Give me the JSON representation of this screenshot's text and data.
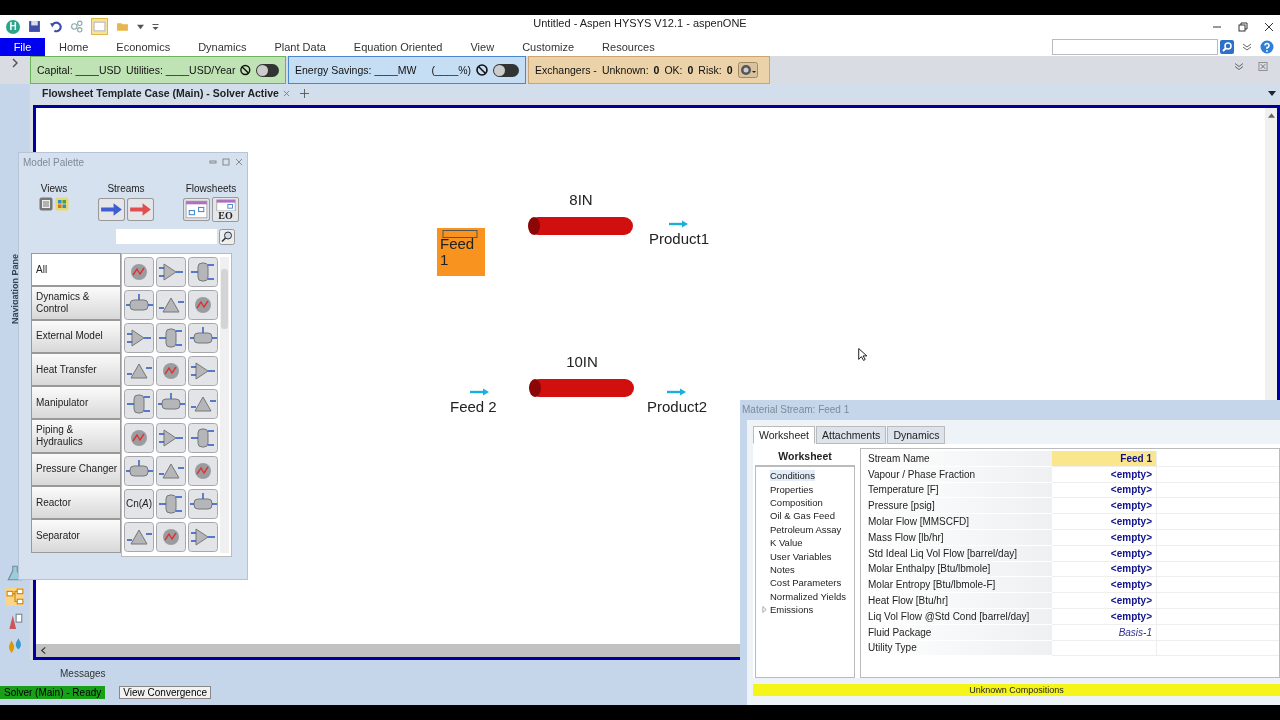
{
  "window": {
    "app_badge": "H",
    "title": "Untitled - Aspen HYSYS V12.1 - aspenONE"
  },
  "ribbon": {
    "file_tab": "File",
    "tabs": [
      {
        "label": "Home",
        "selected": false
      },
      {
        "label": "Economics",
        "selected": false
      },
      {
        "label": "Dynamics",
        "selected": false
      },
      {
        "label": "Plant Data",
        "selected": false
      },
      {
        "label": "Equation Oriented",
        "selected": false
      },
      {
        "label": "View",
        "selected": false
      },
      {
        "label": "Customize",
        "selected": false
      },
      {
        "label": "Resources",
        "selected": false
      }
    ]
  },
  "economics_bar": {
    "capital": "Capital: ____USD",
    "utilities": "Utilities: ____USD/Year",
    "on": false
  },
  "energy_bar": {
    "savings": "Energy Savings: ____MW",
    "percent": "(____%)",
    "on": false
  },
  "exchangers_bar": {
    "label": "Exchangers -",
    "counts": [
      {
        "label": "Unknown:",
        "value": "0"
      },
      {
        "label": "OK:",
        "value": "0"
      },
      {
        "label": "Risk:",
        "value": "0"
      }
    ]
  },
  "document_tab": {
    "label": "Flowsheet Template Case (Main) - Solver Active"
  },
  "navigation_pane": {
    "label": "Navigation Pane"
  },
  "model_palette": {
    "title": "Model Palette",
    "groups": [
      "Views",
      "Streams",
      "Flowsheets"
    ],
    "eo_label": "EO",
    "categories": [
      {
        "label": "All",
        "selected": true
      },
      {
        "label": "Dynamics & Control",
        "selected": false
      },
      {
        "label": "External Model",
        "selected": false
      },
      {
        "label": "Heat Transfer",
        "selected": false
      },
      {
        "label": "Manipulator",
        "selected": false
      },
      {
        "label": "Piping & Hydraulics",
        "selected": false
      },
      {
        "label": "Pressure Changer",
        "selected": false
      },
      {
        "label": "Reactor",
        "selected": false
      },
      {
        "label": "Separator",
        "selected": false
      }
    ],
    "formula_tile": "Cn(*A*)"
  },
  "flowsheet": {
    "objects": [
      {
        "kind": "stream",
        "label": "Feed 1",
        "selected": true
      },
      {
        "kind": "pipe",
        "label": "8IN",
        "selected": false
      },
      {
        "kind": "stream",
        "label": "Product1",
        "selected": false
      },
      {
        "kind": "stream",
        "label": "Feed 2",
        "selected": false
      },
      {
        "kind": "pipe",
        "label": "10IN",
        "selected": false
      },
      {
        "kind": "stream",
        "label": "Product2",
        "selected": false
      }
    ]
  },
  "material_stream": {
    "title": "Material Stream: Feed 1",
    "tabs": [
      {
        "label": "Worksheet",
        "selected": true
      },
      {
        "label": "Attachments",
        "selected": false
      },
      {
        "label": "Dynamics",
        "selected": false
      }
    ],
    "nav_heading": "Worksheet",
    "nav_items": [
      {
        "label": "Conditions",
        "selected": true
      },
      {
        "label": "Properties",
        "selected": false
      },
      {
        "label": "Composition",
        "selected": false
      },
      {
        "label": "Oil & Gas Feed",
        "selected": false
      },
      {
        "label": "Petroleum Assay",
        "selected": false
      },
      {
        "label": "K Value",
        "selected": false
      },
      {
        "label": "User Variables",
        "selected": false
      },
      {
        "label": "Notes",
        "selected": false
      },
      {
        "label": "Cost Parameters",
        "selected": false
      },
      {
        "label": "Normalized Yields",
        "selected": false
      },
      {
        "label": "Emissions",
        "selected": false,
        "expanded": false
      }
    ],
    "rows": [
      {
        "name": "Stream Name",
        "value": "Feed 1",
        "kind": "name"
      },
      {
        "name": "Vapour / Phase Fraction",
        "value": "<empty>",
        "kind": "empty"
      },
      {
        "name": "Temperature [F]",
        "value": "<empty>",
        "kind": "empty"
      },
      {
        "name": "Pressure [psig]",
        "value": "<empty>",
        "kind": "empty"
      },
      {
        "name": "Molar Flow [MMSCFD]",
        "value": "<empty>",
        "kind": "empty"
      },
      {
        "name": "Mass Flow [lb/hr]",
        "value": "<empty>",
        "kind": "empty"
      },
      {
        "name": "Std Ideal Liq Vol Flow [barrel/day]",
        "value": "<empty>",
        "kind": "empty"
      },
      {
        "name": "Molar Enthalpy [Btu/lbmole]",
        "value": "<empty>",
        "kind": "empty"
      },
      {
        "name": "Molar Entropy [Btu/lbmole-F]",
        "value": "<empty>",
        "kind": "empty"
      },
      {
        "name": "Heat Flow [Btu/hr]",
        "value": "<empty>",
        "kind": "empty"
      },
      {
        "name": "Liq Vol Flow @Std Cond [barrel/day]",
        "value": "<empty>",
        "kind": "empty"
      },
      {
        "name": "Fluid Package",
        "value": "Basis-1",
        "kind": "link"
      },
      {
        "name": "Utility Type",
        "kind": "blank"
      }
    ],
    "status": "Unknown Compositions"
  },
  "bottom_panel": {
    "tab": "Messages",
    "solver_status": "Solver (Main) - Ready",
    "button": "View Convergence"
  }
}
